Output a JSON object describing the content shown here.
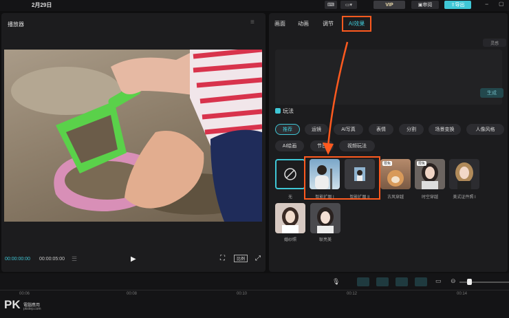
{
  "topbar": {
    "date": "2月29日",
    "vip": "VIP",
    "review": "审阅",
    "export": "导出"
  },
  "player": {
    "title": "播放器",
    "timecode": "00:00:00:00",
    "duration": "00:00:05:00",
    "ratio_label": "比例"
  },
  "tabs": [
    "画面",
    "动画",
    "调节",
    "AI效果"
  ],
  "prompt": {
    "top_chip": "灵感",
    "gen": "生成"
  },
  "play": {
    "label": "玩法"
  },
  "chips_row1": [
    "推荐",
    "运镜",
    "AI写真",
    "表情",
    "分割",
    "场景变换",
    "人像风格"
  ],
  "chips_row2": [
    "AI绘画",
    "节日",
    "视频玩法"
  ],
  "cards_row1": [
    {
      "label": "无",
      "badge": ""
    },
    {
      "label": "智能扩图 I",
      "badge": ""
    },
    {
      "label": "智能扩图 II",
      "badge": ""
    },
    {
      "label": "古风穿越",
      "badge": "限免"
    },
    {
      "label": "时空穿越",
      "badge": "限免"
    },
    {
      "label": "美式证件照 I",
      "badge": ""
    }
  ],
  "cards_row2": [
    {
      "label": "婚纱照"
    },
    {
      "label": "耿亮美"
    }
  ],
  "timeline": {
    "ticks": [
      "00:06",
      "00:08",
      "00:10",
      "00:12",
      "00:14"
    ]
  },
  "watermark": {
    "logo": "PK",
    "text": "電腦應用",
    "sub": "pkstep.com"
  },
  "colors": {
    "accent": "#3fc7d6",
    "callout": "#ff5a1f"
  }
}
